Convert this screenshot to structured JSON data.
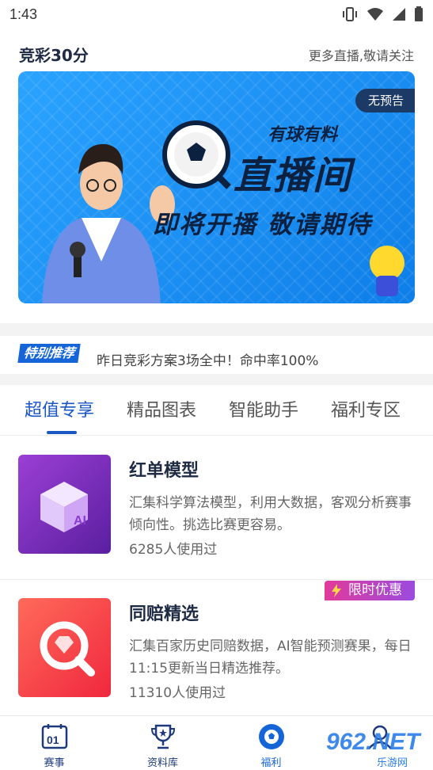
{
  "status_bar": {
    "time": "1:43",
    "icons": [
      "vibrate-icon",
      "wifi-icon",
      "signal-icon",
      "battery-icon"
    ]
  },
  "header": {
    "title": "竞彩30分",
    "link": "更多直播,敬请关注"
  },
  "banner": {
    "badge": "无预告",
    "line1": "有球有料",
    "line2": "直播间",
    "line3": "即将开播 敬请期待"
  },
  "recommend": {
    "badge": "特别推荐",
    "text": "昨日竞彩方案3场全中！命中率100%"
  },
  "tabs": [
    {
      "label": "超值专享",
      "active": true
    },
    {
      "label": "精品图表",
      "active": false
    },
    {
      "label": "智能助手",
      "active": false
    },
    {
      "label": "福利专区",
      "active": false
    }
  ],
  "cards": [
    {
      "title": "红单模型",
      "desc": "汇集科学算法模型，利用大数据，客观分析赛事倾向性。挑选比赛更容易。",
      "usage": "6285人使用过",
      "icon": "ai-cube-icon",
      "color": "#7a2fbf"
    },
    {
      "title": "同赔精选",
      "desc": "汇集百家历史同赔数据，AI智能预测赛果，每日11:15更新当日精选推荐。",
      "usage": "11310人使用过",
      "icon": "diamond-search-icon",
      "color": "#f23a4a",
      "promo": "限时优惠"
    }
  ],
  "bottom_nav": [
    {
      "label": "赛事",
      "icon": "scoreboard-icon",
      "active": false
    },
    {
      "label": "资料库",
      "icon": "trophy-icon",
      "active": false
    },
    {
      "label": "福利",
      "icon": "soccer-ball-icon",
      "active": true
    },
    {
      "label": "",
      "icon": "profile-icon",
      "active": false
    }
  ],
  "watermark": {
    "main": "962.NET",
    "sub": "乐游网"
  },
  "colors": {
    "accent": "#1a56c4",
    "banner": "#1a8ff0",
    "nav_text": "#1f3a7a"
  }
}
